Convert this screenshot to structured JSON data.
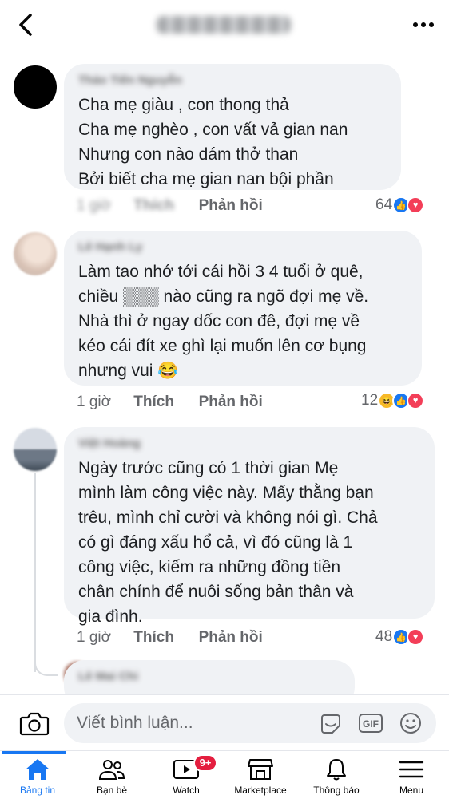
{
  "header": {
    "title": "Bài viết của Bống"
  },
  "comments": [
    {
      "author": "Thảo Tiến Nguyễn",
      "text": "Cha mẹ giàu , con thong thả\nCha mẹ nghèo , con vất vả gian nan\nNhưng con nào dám thở than\nBởi biết cha mẹ gian nan bội phần",
      "time": "1 giờ",
      "like_label": "Thích",
      "reply_label": "Phản hồi",
      "reaction_count": "64",
      "reactions": [
        "like-icon",
        "love-icon"
      ]
    },
    {
      "author": "Lê Hạnh Ly",
      "text": "Làm tao nhớ tới cái hồi 3 4 tuổi ở quê,\nchiều ▒▒▒ nào cũng ra ngõ đợi mẹ về.\nNhà thì ở ngay dốc con đê, đợi mẹ về\nkéo cái đít xe ghì lại muốn lên cơ bụng\nnhưng vui 😂",
      "time": "1 giờ",
      "like_label": "Thích",
      "reply_label": "Phản hồi",
      "reaction_count": "12",
      "reactions": [
        "haha-icon",
        "like-icon",
        "love-icon"
      ]
    },
    {
      "author": "Việt Hoàng",
      "text": "Ngày trước cũng có 1 thời gian Mẹ\nmình làm công việc này. Mấy thằng bạn\ntrêu, mình chỉ cười và không nói gì. Chả\ncó gì đáng xấu hổ cả, vì đó cũng là 1\ncông việc, kiếm ra những đồng tiền\nchân chính để nuôi sống bản thân và\ngia đình.",
      "time": "1 giờ",
      "like_label": "Thích",
      "reply_label": "Phản hồi",
      "reaction_count": "48",
      "reactions": [
        "like-icon",
        "love-icon"
      ]
    },
    {
      "author": "Lê Mai Chi"
    }
  ],
  "composer": {
    "placeholder": "Viết bình luận...",
    "icons": [
      "camera-icon",
      "sticker-icon",
      "gif-icon",
      "emoji-icon"
    ]
  },
  "tabs": [
    {
      "label": "Bảng tin",
      "icon": "home-icon",
      "active": true
    },
    {
      "label": "Bạn bè",
      "icon": "friends-icon"
    },
    {
      "label": "Watch",
      "icon": "watch-icon",
      "badge": "9+"
    },
    {
      "label": "Marketplace",
      "icon": "marketplace-icon"
    },
    {
      "label": "Thông báo",
      "icon": "bell-icon"
    },
    {
      "label": "Menu",
      "icon": "menu-icon"
    }
  ],
  "colors": {
    "accent": "#1877f2",
    "badge": "#e41e3f",
    "bubble": "#f0f2f5",
    "love": "#f33e58"
  }
}
